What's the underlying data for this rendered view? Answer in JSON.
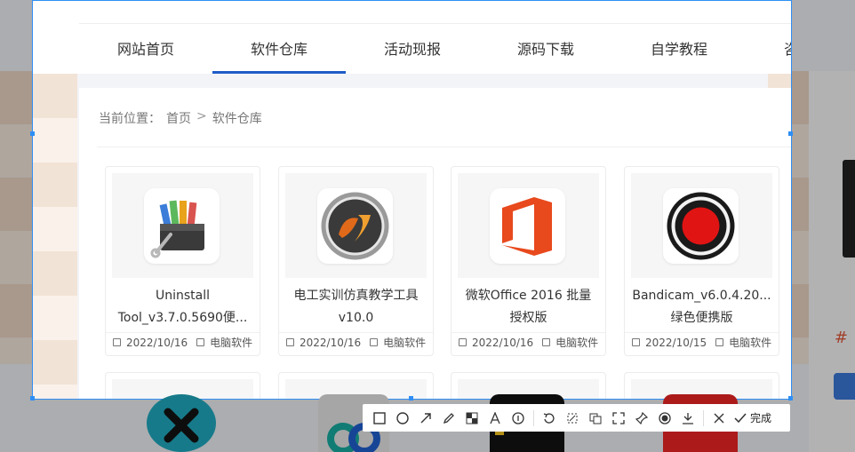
{
  "nav": {
    "items": [
      {
        "label": "网站首页",
        "active": false
      },
      {
        "label": "软件仓库",
        "active": true
      },
      {
        "label": "活动现报",
        "active": false
      },
      {
        "label": "源码下载",
        "active": false
      },
      {
        "label": "自学教程",
        "active": false
      },
      {
        "label": "咨讯教程",
        "active": false
      }
    ]
  },
  "breadcrumb": {
    "prefix": "当前位置：",
    "home": "首页",
    "separator": ">",
    "current": "软件仓库"
  },
  "cards": [
    {
      "line1": "Uninstall",
      "line2": "Tool_v3.7.0.5690便...",
      "date": "2022/10/16",
      "category": "电脑软件",
      "icon": "uninstall-tool-icon"
    },
    {
      "line1": "电工实训仿真教学工具",
      "line2": "v10.0",
      "date": "2022/10/16",
      "category": "电脑软件",
      "icon": "electrician-sim-icon"
    },
    {
      "line1": "微软Office 2016 批量",
      "line2": "授权版",
      "date": "2022/10/16",
      "category": "电脑软件",
      "icon": "office-icon"
    },
    {
      "line1": "Bandicam_v6.0.4.20...",
      "line2": "绿色便携版",
      "date": "2022/10/15",
      "category": "电脑软件",
      "icon": "bandicam-icon"
    }
  ],
  "side_rail": {
    "mark": "#"
  },
  "toolbar": {
    "tools": [
      "rectangle-tool",
      "ellipse-tool",
      "arrow-tool",
      "pen-tool",
      "mosaic-tool",
      "text-tool",
      "number-tool",
      "undo",
      "crop-tool",
      "ocr-tool",
      "fullscreen-tool",
      "pin-tool",
      "record-tool",
      "save-tool",
      "cancel"
    ],
    "done_label": "完成"
  },
  "colors": {
    "accent": "#1e5cc8",
    "selection": "#2f8ff5",
    "office": "#e8491d",
    "bandicam": "#e11414"
  }
}
